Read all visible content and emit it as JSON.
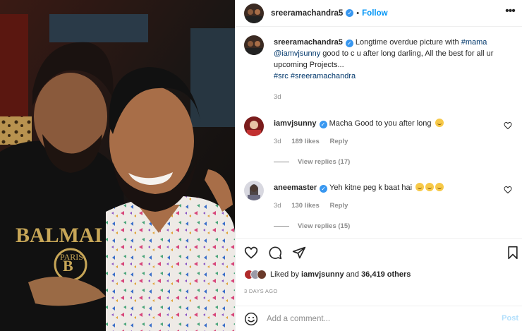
{
  "header": {
    "username": "sreeramachandra5",
    "verified_icon": "verified-badge-icon",
    "separator": "•",
    "follow_label": "Follow",
    "more_icon": "more-options-icon"
  },
  "caption": {
    "username": "sreeramachandra5",
    "text_before": " Longtime overdue picture with ",
    "mention1": "#mama",
    "mention2": "@iamvjsunny",
    "text_after": " good to c u after long darling, All the best for all ur upcoming Projects...",
    "hashtag1": "#src",
    "hashtag2": "#sreeramachandra",
    "age": "3d"
  },
  "comments": [
    {
      "username": "iamvjsunny",
      "text": "Macha Good to you after long",
      "age": "3d",
      "likes": "189 likes",
      "reply_label": "Reply",
      "view_replies": "View replies (17)"
    },
    {
      "username": "aneemaster",
      "text": "Yeh kitne peg k baat hai",
      "age": "3d",
      "likes": "130 likes",
      "reply_label": "Reply",
      "view_replies": "View replies (15)"
    }
  ],
  "actions": {
    "icons": [
      "heart-icon",
      "comment-icon",
      "share-icon",
      "bookmark-icon"
    ],
    "liked_by_prefix": "Liked by",
    "liked_by_user": "iamvjsunny",
    "liked_by_and": "and",
    "liked_by_count": "36,419 others",
    "timestamp": "3 DAYS AGO"
  },
  "comment_box": {
    "placeholder": "Add a comment...",
    "post_label": "Post",
    "emoji_icon": "smiley-icon"
  },
  "colors": {
    "accent": "#0095f6",
    "verified": "#3897f0",
    "muted": "#8e8e8e",
    "post_disabled": "#b2dffc"
  }
}
